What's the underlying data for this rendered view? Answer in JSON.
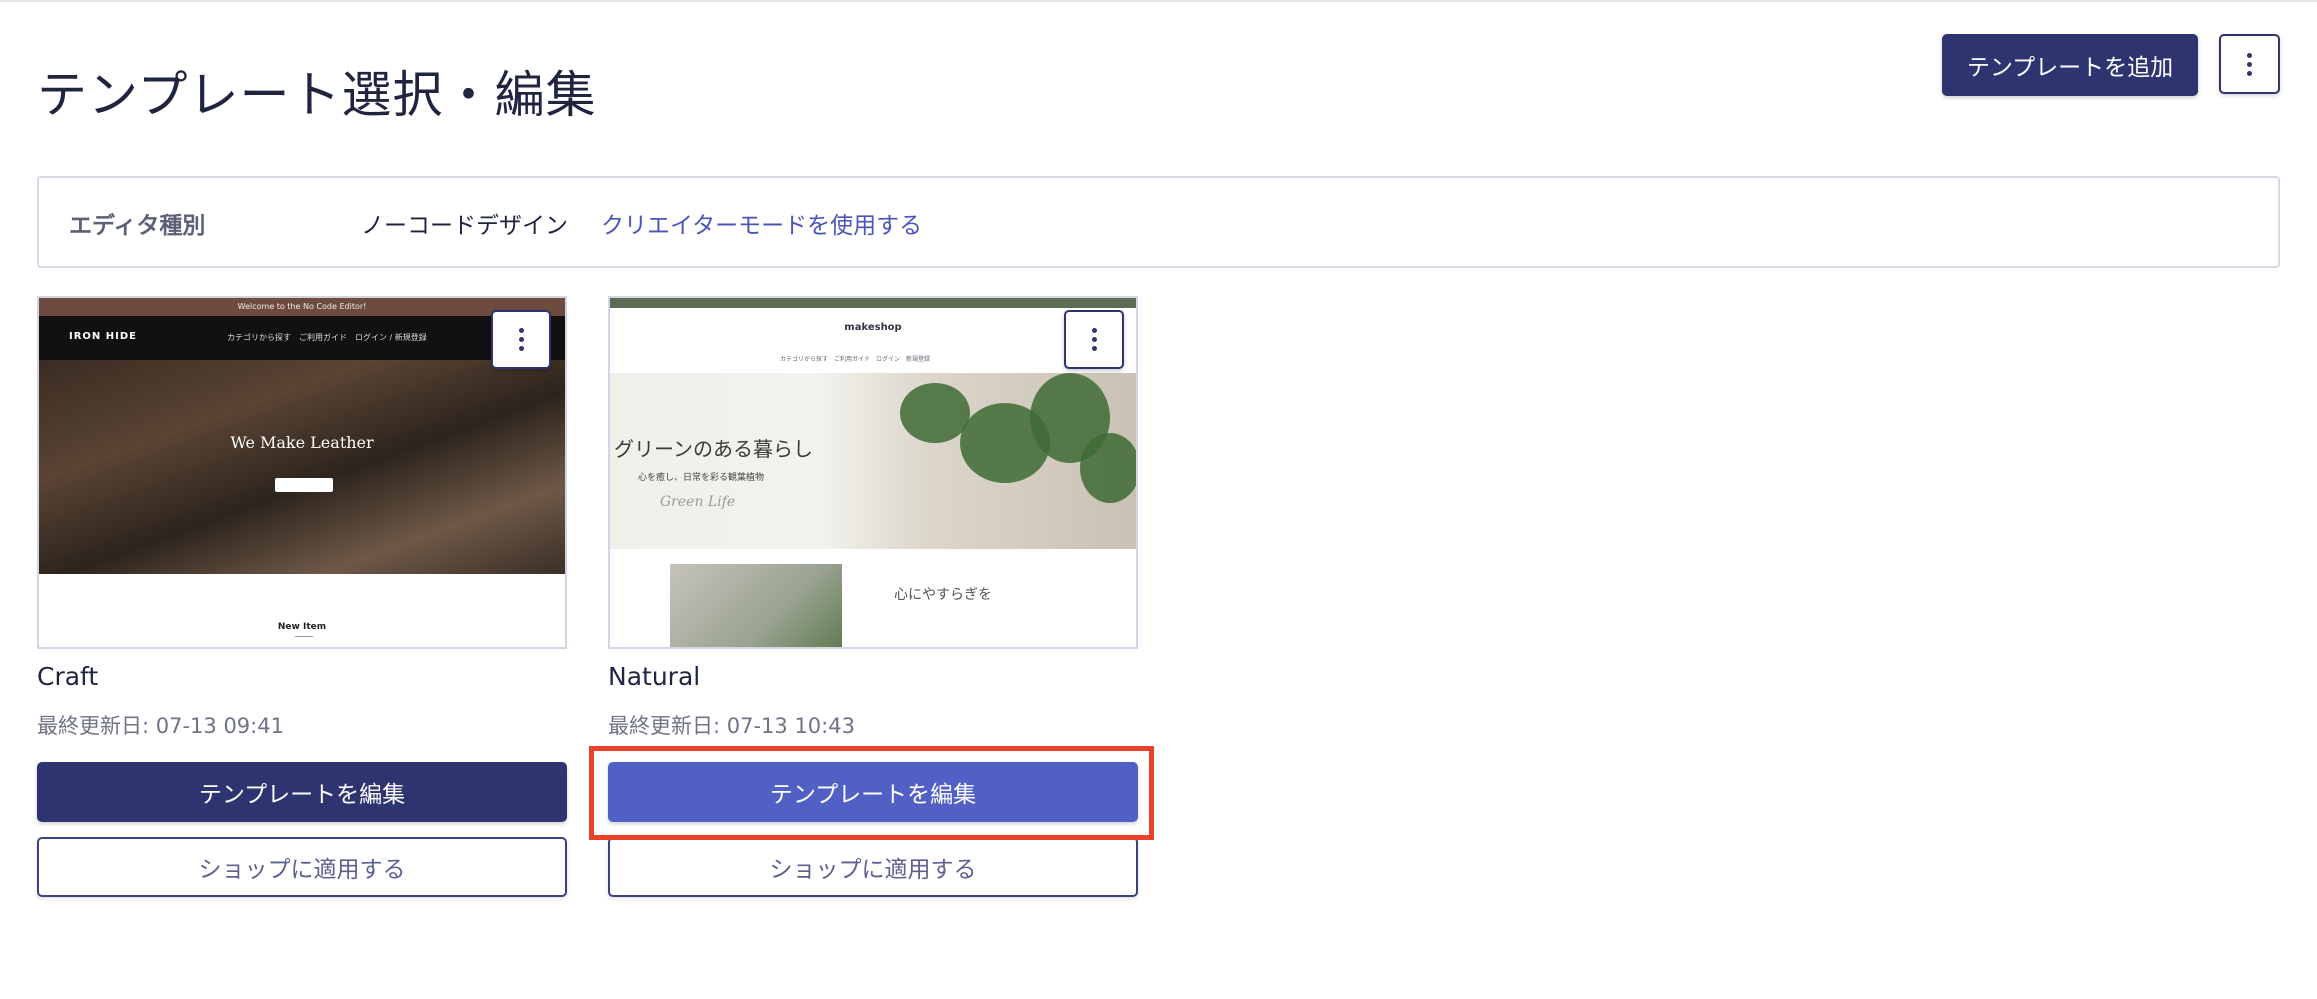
{
  "header": {
    "title": "テンプレート選択・編集",
    "add_button": "テンプレートを追加"
  },
  "editor": {
    "label": "エディタ種別",
    "value": "ノーコードデザイン",
    "link": "クリエイターモードを使用する"
  },
  "templates": [
    {
      "name": "Craft",
      "updated": "最終更新日: 07-13 09:41",
      "edit_label": "テンプレートを編集",
      "apply_label": "ショップに適用する",
      "thumb": {
        "top_text": "Welcome to the No Code Editor!",
        "logo": "IRON HIDE",
        "menu": "カテゴリから探す　ご利用ガイド　ログイン / 新規登録",
        "hero_title": "We Make Leather",
        "footer": "New Item"
      }
    },
    {
      "name": "Natural",
      "updated": "最終更新日: 07-13 10:43",
      "edit_label": "テンプレートを編集",
      "apply_label": "ショップに適用する",
      "thumb": {
        "logo": "makeshop",
        "menu": "カテゴリから探す　ご利用ガイド　ログイン　新規登録",
        "hero_title": "グリーンのある暮らし",
        "hero_sub": "心を癒し、日常を彩る観葉植物",
        "hero_script": "Green Life",
        "section_title": "心にやすらぎを"
      }
    }
  ],
  "colors": {
    "primary": "#2d3470",
    "primary_active": "#5060c4",
    "link": "#4a56b7",
    "highlight": "#e8432a"
  }
}
